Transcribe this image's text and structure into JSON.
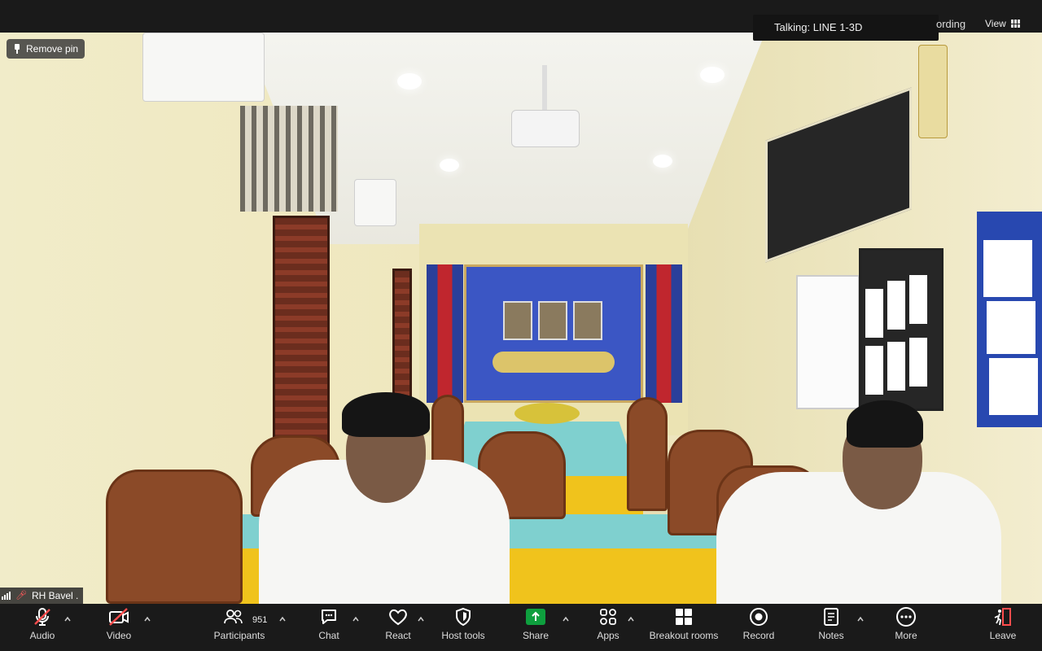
{
  "top": {
    "talking_label": "Talking: LINE 1-3D",
    "recording_fragment": "ording",
    "view_label": "View"
  },
  "overlay": {
    "remove_pin_label": "Remove pin",
    "participant_name": "RH Bavel ."
  },
  "toolbar": {
    "audio_label": "Audio",
    "video_label": "Video",
    "participants_label": "Participants",
    "participants_count": "951",
    "chat_label": "Chat",
    "react_label": "React",
    "host_tools_label": "Host tools",
    "share_label": "Share",
    "apps_label": "Apps",
    "breakout_label": "Breakout rooms",
    "record_label": "Record",
    "notes_label": "Notes",
    "more_label": "More",
    "leave_label": "Leave"
  },
  "colors": {
    "bar_bg": "#1a1a1a",
    "share_green": "#0e9f3e",
    "muted_red": "#ff4d4d",
    "leave_red": "#ff4d4d"
  }
}
